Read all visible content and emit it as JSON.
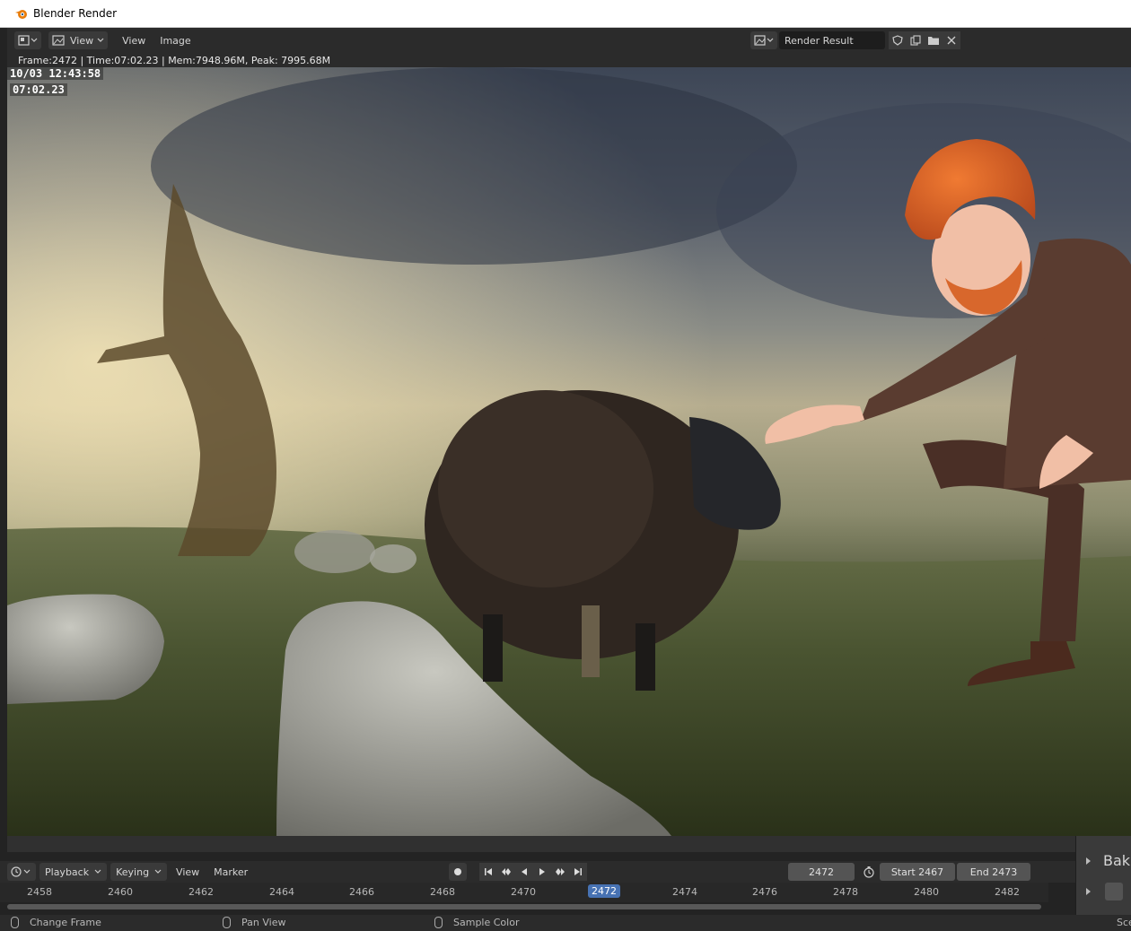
{
  "window": {
    "title": "Blender Render"
  },
  "header": {
    "view_label": "View",
    "menu_view": "View",
    "menu_image": "Image",
    "render_result": "Render Result"
  },
  "meta": {
    "info": "Frame:2472 | Time:07:02.23 | Mem:7948.96M, Peak: 7995.68M"
  },
  "stamp": {
    "datetime": "10/03 12:43:58",
    "render_time": "07:02.23"
  },
  "timeline": {
    "playback": "Playback",
    "keying": "Keying",
    "view": "View",
    "marker": "Marker",
    "current_frame": "2472",
    "start": "Start  2467",
    "end": "End  2473",
    "ticks": [
      "2458",
      "2460",
      "2462",
      "2464",
      "2466",
      "2468",
      "2470",
      "2472",
      "2474",
      "2476",
      "2478",
      "2480",
      "2482"
    ],
    "current_tick": "2472"
  },
  "status": {
    "left": "Change Frame",
    "middle": "Pan View",
    "right": "Sample Color",
    "far_right": "Sce"
  },
  "props": {
    "label": "Bak"
  },
  "colors": {
    "accent": "#4772b3",
    "bg": "#232323",
    "header": "#2b2b2b"
  }
}
